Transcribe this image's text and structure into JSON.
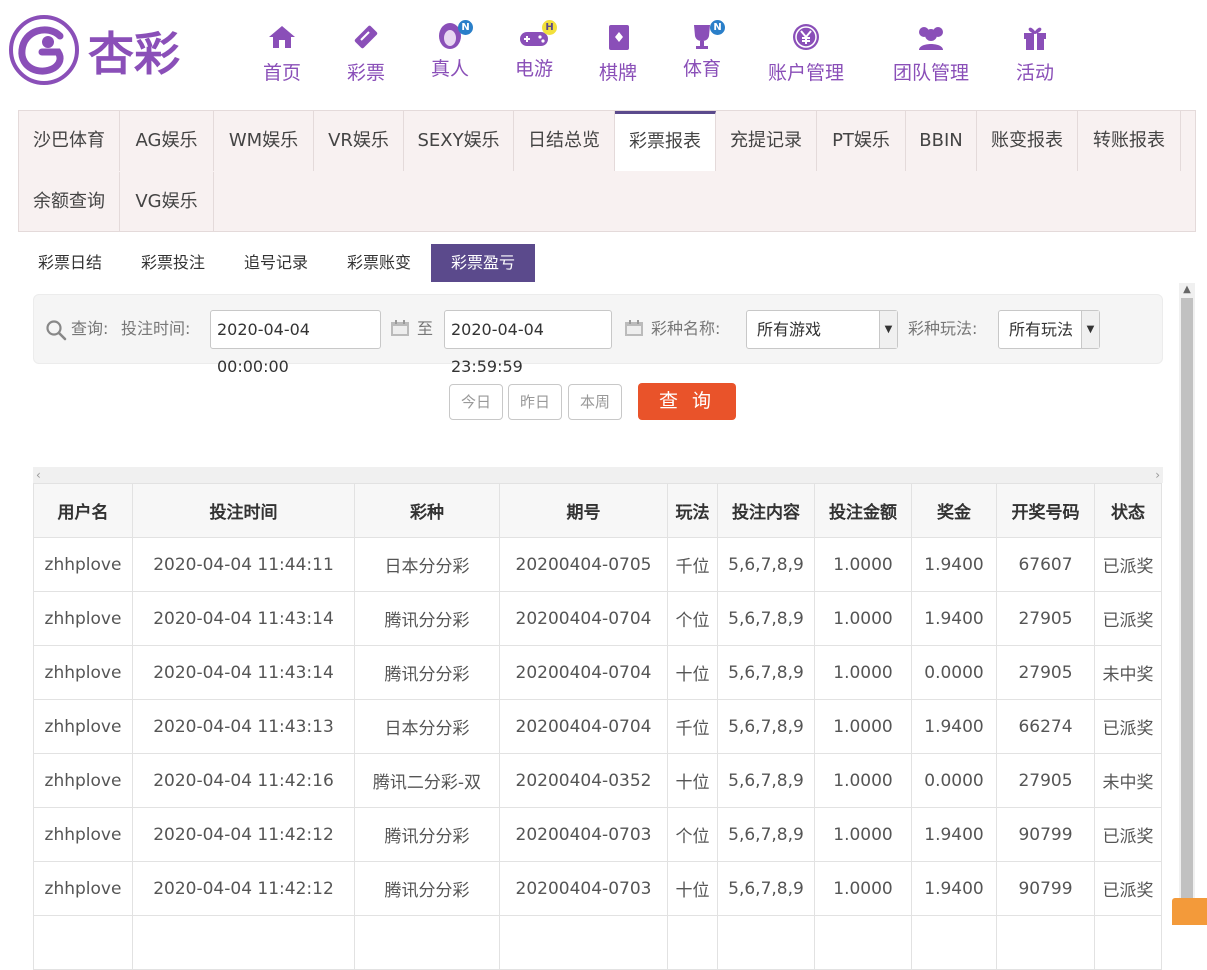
{
  "logo": {
    "text": "杏彩"
  },
  "nav": [
    {
      "label": "首页",
      "icon": "home-icon",
      "badge": ""
    },
    {
      "label": "彩票",
      "icon": "ticket-icon",
      "badge": ""
    },
    {
      "label": "真人",
      "icon": "live-dealer-icon",
      "badge": "N"
    },
    {
      "label": "电游",
      "icon": "gamepad-icon",
      "badge": "H"
    },
    {
      "label": "棋牌",
      "icon": "cards-icon",
      "badge": ""
    },
    {
      "label": "体育",
      "icon": "trophy-icon",
      "badge": "N"
    },
    {
      "label": "账户管理",
      "icon": "yen-icon",
      "badge": ""
    },
    {
      "label": "团队管理",
      "icon": "team-icon",
      "badge": ""
    },
    {
      "label": "活动",
      "icon": "gift-icon",
      "badge": ""
    }
  ],
  "report_tabs": [
    "沙巴体育",
    "AG娱乐",
    "WM娱乐",
    "VR娱乐",
    "SEXY娱乐",
    "日结总览",
    "彩票报表",
    "充提记录",
    "PT娱乐",
    "BBIN",
    "账变报表",
    "转账报表",
    "余额查询",
    "VG娱乐"
  ],
  "report_tab_active": "彩票报表",
  "sub_tabs": [
    "彩票日结",
    "彩票投注",
    "追号记录",
    "彩票账变",
    "彩票盈亏"
  ],
  "sub_tab_active": "彩票盈亏",
  "query": {
    "label": "查询:",
    "time_label": "投注时间:",
    "start": "2020-04-04 00:00:00",
    "to": "至",
    "end": "2020-04-04 23:59:59",
    "lottery_label": "彩种名称:",
    "lottery_value": "所有游戏",
    "play_label": "彩种玩法:",
    "play_value": "所有玩法",
    "quick": [
      "今日",
      "昨日",
      "本周"
    ],
    "search_button": "查 询"
  },
  "table": {
    "headers": [
      "用户名",
      "投注时间",
      "彩种",
      "期号",
      "玩法",
      "投注内容",
      "投注金额",
      "奖金",
      "开奖号码",
      "状态"
    ],
    "rows": [
      [
        "zhhplove",
        "2020-04-04 11:44:11",
        "日本分分彩",
        "20200404-0705",
        "千位",
        "5,6,7,8,9",
        "1.0000",
        "1.9400",
        "67607",
        "已派奖"
      ],
      [
        "zhhplove",
        "2020-04-04 11:43:14",
        "腾讯分分彩",
        "20200404-0704",
        "个位",
        "5,6,7,8,9",
        "1.0000",
        "1.9400",
        "27905",
        "已派奖"
      ],
      [
        "zhhplove",
        "2020-04-04 11:43:14",
        "腾讯分分彩",
        "20200404-0704",
        "十位",
        "5,6,7,8,9",
        "1.0000",
        "0.0000",
        "27905",
        "未中奖"
      ],
      [
        "zhhplove",
        "2020-04-04 11:43:13",
        "日本分分彩",
        "20200404-0704",
        "千位",
        "5,6,7,8,9",
        "1.0000",
        "1.9400",
        "66274",
        "已派奖"
      ],
      [
        "zhhplove",
        "2020-04-04 11:42:16",
        "腾讯二分彩-双",
        "20200404-0352",
        "十位",
        "5,6,7,8,9",
        "1.0000",
        "0.0000",
        "27905",
        "未中奖"
      ],
      [
        "zhhplove",
        "2020-04-04 11:42:12",
        "腾讯分分彩",
        "20200404-0703",
        "个位",
        "5,6,7,8,9",
        "1.0000",
        "1.9400",
        "90799",
        "已派奖"
      ],
      [
        "zhhplove",
        "2020-04-04 11:42:12",
        "腾讯分分彩",
        "20200404-0703",
        "十位",
        "5,6,7,8,9",
        "1.0000",
        "1.9400",
        "90799",
        "已派奖"
      ],
      [
        "",
        "",
        "",
        "",
        "",
        "",
        "",
        "",
        "",
        ""
      ]
    ]
  },
  "colors": {
    "accent": "#5b4a8c",
    "nav_text": "#8a4fb8",
    "search": "#e9532a",
    "paid": "#e67e22"
  }
}
